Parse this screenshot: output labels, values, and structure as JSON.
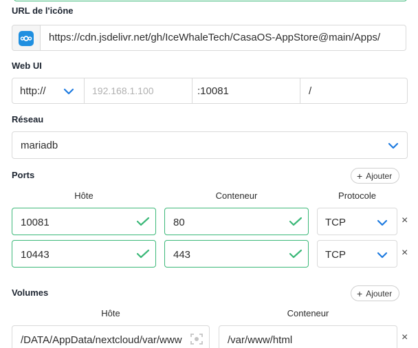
{
  "icon_url": {
    "label": "URL de l'icône",
    "value": "https://cdn.jsdelivr.net/gh/IceWhaleTech/CasaOS-AppStore@main/Apps/"
  },
  "web_ui": {
    "label": "Web UI",
    "protocol": "http://",
    "host_placeholder": "192.168.1.100",
    "port": ":10081",
    "path": "/"
  },
  "network": {
    "label": "Réseau",
    "value": "mariadb"
  },
  "ports": {
    "label": "Ports",
    "add_label": "Ajouter",
    "col_host": "Hôte",
    "col_container": "Conteneur",
    "col_protocol": "Protocole",
    "rows": [
      {
        "host": "10081",
        "container": "80",
        "protocol": "TCP"
      },
      {
        "host": "10443",
        "container": "443",
        "protocol": "TCP"
      }
    ]
  },
  "volumes": {
    "label": "Volumes",
    "add_label": "Ajouter",
    "col_host": "Hôte",
    "col_container": "Conteneur",
    "rows": [
      {
        "host": "/DATA/AppData/nextcloud/var/www",
        "container": "/var/www/html"
      }
    ]
  },
  "colors": {
    "accent": "#1f7be0",
    "valid": "#3bb878",
    "border": "#d9d9d9"
  },
  "icons": {
    "remove": "×",
    "add": "+"
  }
}
